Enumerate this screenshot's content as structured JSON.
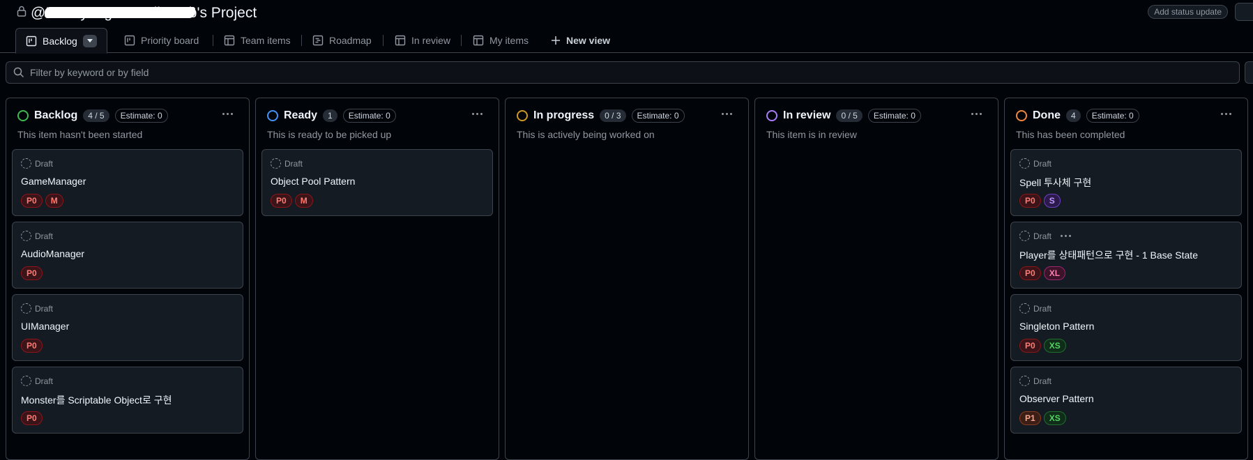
{
  "header": {
    "title": "@LeeHyungwon-AllInLab's Project",
    "status_button": "Add status update"
  },
  "tabs": [
    {
      "label": "Backlog",
      "icon": "board-icon"
    },
    {
      "label": "Priority board",
      "icon": "board-icon"
    },
    {
      "label": "Team items",
      "icon": "table-icon"
    },
    {
      "label": "Roadmap",
      "icon": "roadmap-icon"
    },
    {
      "label": "In review",
      "icon": "table-icon"
    },
    {
      "label": "My items",
      "icon": "table-icon"
    },
    {
      "label": "New view",
      "icon": "plus-icon"
    }
  ],
  "filter": {
    "placeholder": "Filter by keyword or by field"
  },
  "columns": [
    {
      "title": "Backlog",
      "count": "4 / 5",
      "estimate": "Estimate: 0",
      "description": "This item hasn't been started",
      "color": "#3fb950",
      "cards": [
        {
          "status": "Draft",
          "title": "GameManager",
          "labels": [
            "P0",
            "M"
          ]
        },
        {
          "status": "Draft",
          "title": "AudioManager",
          "labels": [
            "P0"
          ]
        },
        {
          "status": "Draft",
          "title": "UIManager",
          "labels": [
            "P0"
          ]
        },
        {
          "status": "Draft",
          "title": "Monster를 Scriptable Object로 구현",
          "labels": [
            "P0"
          ]
        }
      ]
    },
    {
      "title": "Ready",
      "count": "1",
      "estimate": "Estimate: 0",
      "description": "This is ready to be picked up",
      "color": "#4493f8",
      "cards": [
        {
          "status": "Draft",
          "title": "Object Pool Pattern",
          "labels": [
            "P0",
            "M"
          ]
        }
      ]
    },
    {
      "title": "In progress",
      "count": "0 / 3",
      "estimate": "Estimate: 0",
      "description": "This is actively being worked on",
      "color": "#d29922",
      "cards": []
    },
    {
      "title": "In review",
      "count": "0 / 5",
      "estimate": "Estimate: 0",
      "description": "This item is in review",
      "color": "#ab7df8",
      "cards": []
    },
    {
      "title": "Done",
      "count": "4",
      "estimate": "Estimate: 0",
      "description": "This has been completed",
      "color": "#f0883e",
      "cards": [
        {
          "status": "Draft",
          "title": "Spell 투사체 구현",
          "labels": [
            "P0",
            "S"
          ]
        },
        {
          "status": "Draft",
          "title": "Player를 상태패턴으로 구현 - 1 Base State",
          "labels": [
            "P0",
            "XL"
          ]
        },
        {
          "status": "Draft",
          "title": "Singleton Pattern",
          "labels": [
            "P0",
            "XS"
          ]
        },
        {
          "status": "Draft",
          "title": "Observer Pattern",
          "labels": [
            "P1",
            "XS"
          ]
        }
      ]
    }
  ]
}
